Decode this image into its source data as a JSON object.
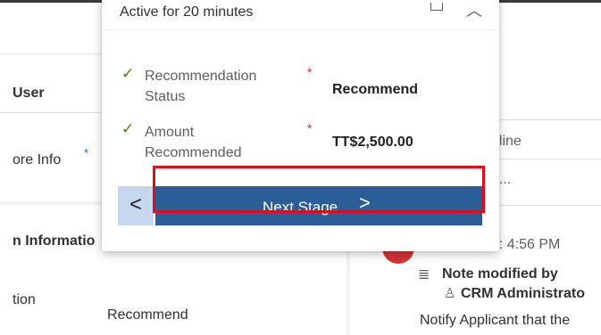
{
  "background": {
    "left": {
      "user_label": "User",
      "more_info_label": "ore Info",
      "section_header": "n Informatio",
      "field_label": "tion",
      "field_value": "Recommend"
    },
    "right": {
      "timeline_label": "eline",
      "search_text": "e...",
      "time_text": "n: 4:56 PM",
      "note_title": "Note modified by",
      "note_author": "CRM Administrato",
      "note_body": "Notify Applicant that the"
    }
  },
  "flyout": {
    "title": "Active for 20 minutes",
    "fields": [
      {
        "label_line1": "Recommendation",
        "label_line2": "Status",
        "value": "Recommend",
        "required_mark": "*",
        "check": "✓"
      },
      {
        "label_line1": "Amount",
        "label_line2": "Recommended",
        "value": "TT$2,500.00",
        "required_mark": "*",
        "check": "✓"
      }
    ],
    "back_glyph": "<",
    "next_label": "Next Stage",
    "next_glyph": ">"
  },
  "colors": {
    "next_button": "#2b5e97",
    "back_button": "#c7d8ee",
    "highlight": "#e30b17",
    "required": "#d13438",
    "check": "#498205"
  },
  "icons": [
    "dock-icon",
    "chevron-up-icon",
    "check-icon",
    "chevron-left-icon",
    "chevron-right-icon",
    "note-icon",
    "person-icon"
  ]
}
